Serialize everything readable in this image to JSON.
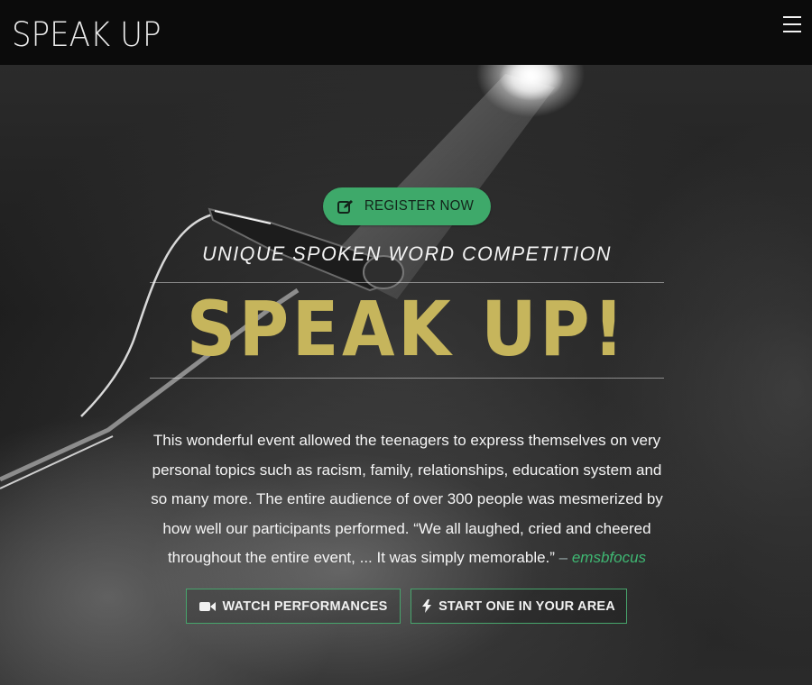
{
  "navbar": {
    "brand": "SPEAK UP",
    "menu_icon": "hamburger-menu-icon"
  },
  "hero": {
    "register_button": {
      "label": "REGISTER NOW",
      "icon": "edit-icon"
    },
    "subtitle": "UNIQUE SPOKEN WORD COMPETITION",
    "headline": "SPEAK UP!",
    "description": "This wonderful event allowed the teenagers to express themselves on very personal topics such as racism, family, relationships, education system and so many more.  The entire audience of over 300 people was mesmerized by how well our participants performed.  “We all laughed, cried and cheered throughout the entire event, ... It was simply memorable.”",
    "attribution_dash": " – ",
    "attribution": "emsbfocus",
    "buttons": [
      {
        "label": "WATCH PERFORMANCES",
        "icon": "video-camera-icon"
      },
      {
        "label": "START ONE IN YOUR AREA",
        "icon": "lightning-bolt-icon"
      }
    ]
  },
  "colors": {
    "accent_green": "#3ea96a",
    "headline_gold": "#c6b55c",
    "navbar": "#0b0b0b"
  }
}
